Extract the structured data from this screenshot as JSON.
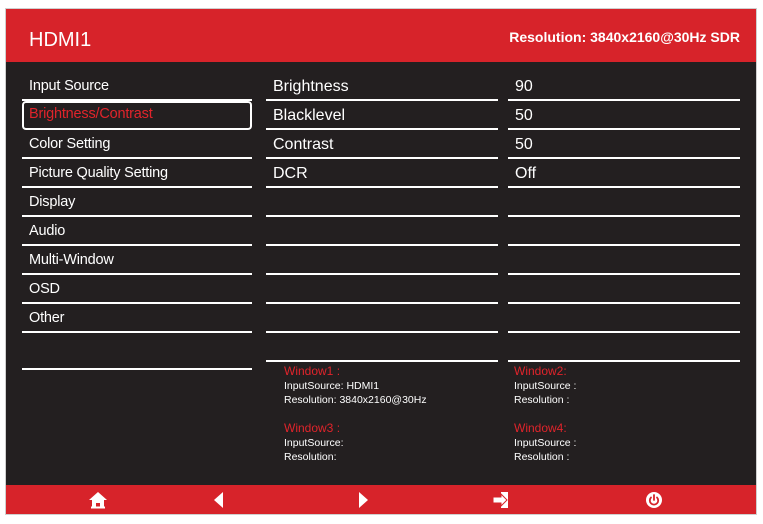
{
  "header": {
    "source": "HDMI1",
    "resolution": "Resolution: 3840x2160@30Hz SDR"
  },
  "menu": {
    "items": [
      {
        "label": "Input Source"
      },
      {
        "label": "Brightness/Contrast"
      },
      {
        "label": "Color Setting"
      },
      {
        "label": "Picture Quality Setting"
      },
      {
        "label": "Display"
      },
      {
        "label": "Audio"
      },
      {
        "label": "Multi-Window"
      },
      {
        "label": "OSD"
      },
      {
        "label": "Other"
      }
    ],
    "selected": "Brightness/Contrast"
  },
  "settings": [
    {
      "name": "Brightness",
      "value": "90"
    },
    {
      "name": "Blacklevel",
      "value": "50"
    },
    {
      "name": "Contrast",
      "value": "50"
    },
    {
      "name": "DCR",
      "value": "Off"
    }
  ],
  "windows": {
    "w1": {
      "title": "Window1 :",
      "source": "InputSource: HDMI1",
      "resolution": "Resolution: 3840x2160@30Hz"
    },
    "w2": {
      "title": "Window2:",
      "source": "InputSource :",
      "resolution": "Resolution :"
    },
    "w3": {
      "title": "Window3 :",
      "source": "InputSource:",
      "resolution": "Resolution:"
    },
    "w4": {
      "title": "Window4:",
      "source": "InputSource :",
      "resolution": "Resolution :"
    }
  },
  "footer": {
    "buttons": [
      "home-icon",
      "left-arrow-icon",
      "right-arrow-icon",
      "exit-icon",
      "power-icon"
    ]
  },
  "colors": {
    "accent": "#d7232a",
    "background": "#231f20",
    "text": "#ffffff"
  }
}
